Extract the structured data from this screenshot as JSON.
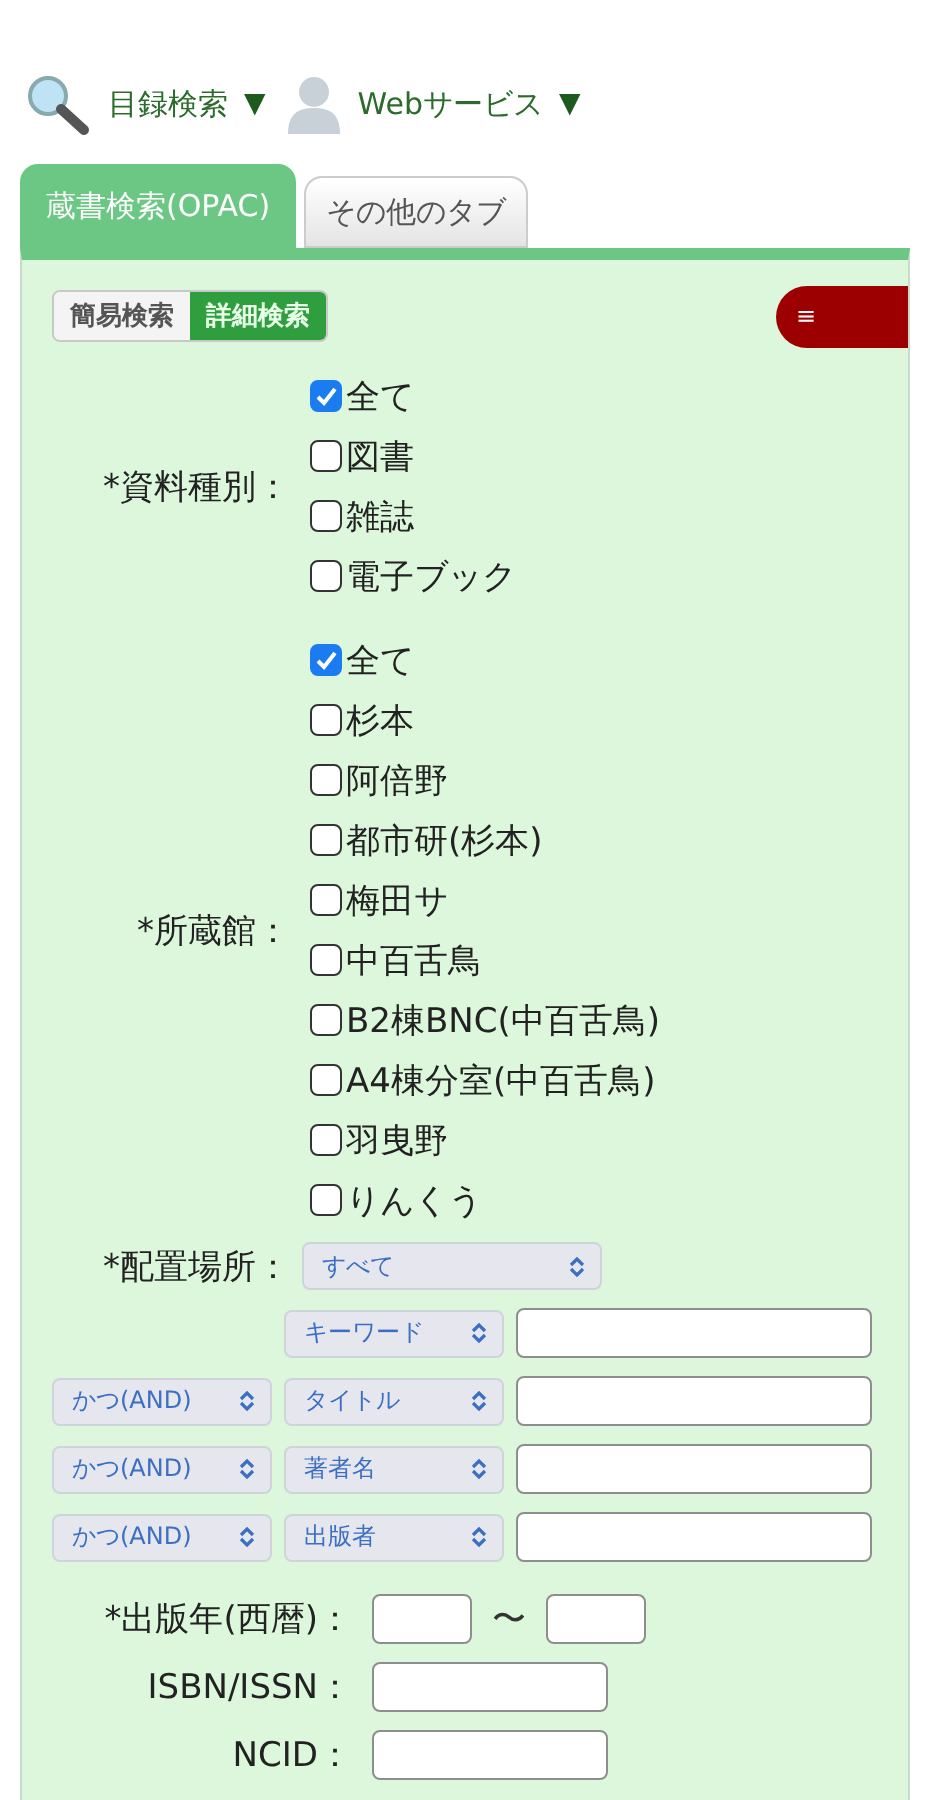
{
  "nav": [
    {
      "label": "目録検索",
      "caret": "▼"
    },
    {
      "label": "Webサービス",
      "caret": "▼"
    }
  ],
  "tabs": [
    {
      "label": "蔵書検索(OPAC)",
      "selected": true
    },
    {
      "label": "その他のタブ",
      "selected": false
    }
  ],
  "mode_switch": [
    {
      "label": "簡易検索",
      "selected": false
    },
    {
      "label": "詳細検索",
      "selected": true
    }
  ],
  "menu_button": {
    "label": "≡"
  },
  "checkbox_groups": [
    {
      "label": "*資料種別：",
      "options": [
        {
          "label": "全て",
          "checked": true
        },
        {
          "label": "図書",
          "checked": false
        },
        {
          "label": "雑誌",
          "checked": false
        },
        {
          "label": "電子ブック",
          "checked": false
        }
      ]
    },
    {
      "label": "*所蔵館：",
      "options": [
        {
          "label": "全て",
          "checked": true
        },
        {
          "label": "杉本",
          "checked": false
        },
        {
          "label": "阿倍野",
          "checked": false
        },
        {
          "label": "都市研(杉本)",
          "checked": false
        },
        {
          "label": "梅田サ",
          "checked": false
        },
        {
          "label": "中百舌鳥",
          "checked": false
        },
        {
          "label": "B2棟BNC(中百舌鳥)",
          "checked": false
        },
        {
          "label": "A4棟分室(中百舌鳥)",
          "checked": false
        },
        {
          "label": "羽曳野",
          "checked": false
        },
        {
          "label": "りんくう",
          "checked": false
        }
      ]
    }
  ],
  "location": {
    "label": "*配置場所：",
    "value": "すべて"
  },
  "search_rows": [
    {
      "field": "キーワード"
    },
    {
      "operator": "かつ(AND)",
      "field": "タイトル"
    },
    {
      "operator": "かつ(AND)",
      "field": "著者名"
    },
    {
      "operator": "かつ(AND)",
      "field": "出版者"
    }
  ],
  "year": {
    "label": "*出版年(西暦)：",
    "separator": "〜"
  },
  "text_fields": [
    {
      "label": "ISBN/ISSN："
    },
    {
      "label": "NCID："
    }
  ]
}
